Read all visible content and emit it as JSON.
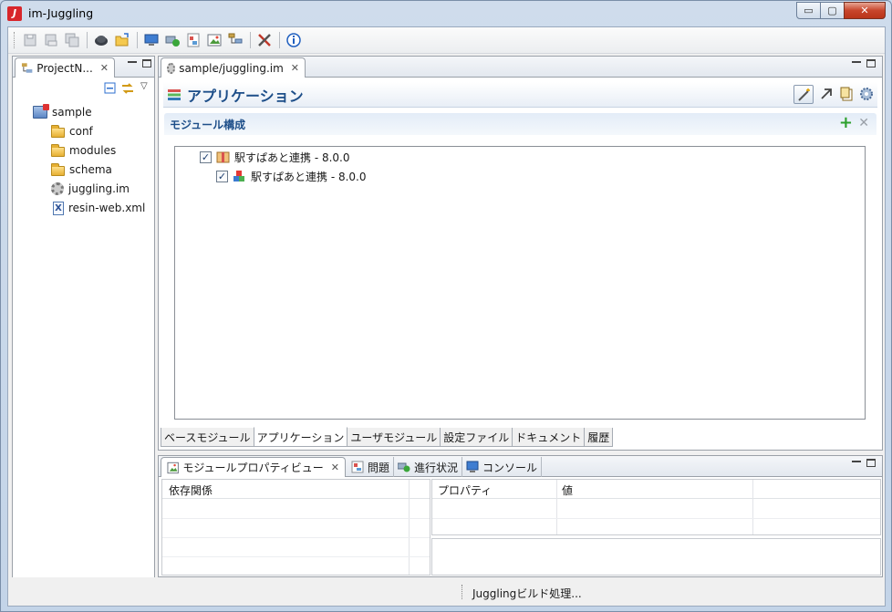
{
  "window": {
    "title": "im-Juggling",
    "controls": {
      "minimize": "▭",
      "maximize": "▢",
      "close": "✕"
    }
  },
  "toolbar": {
    "groups": [
      [
        "save-icon",
        "save-as-icon",
        "save-all-icon"
      ],
      [
        "hat-icon",
        "open-folder-icon"
      ],
      [
        "monitor-icon",
        "deploy-icon",
        "report-icon",
        "image-icon",
        "tree-icon"
      ],
      [
        "tools-icon"
      ],
      [
        "info-icon"
      ]
    ]
  },
  "project_explorer": {
    "tab_label": "ProjectN...",
    "tree": {
      "root": "sample",
      "children": [
        "conf",
        "modules",
        "schema",
        "juggling.im",
        "resin-web.xml"
      ]
    }
  },
  "editor": {
    "tab_label": "sample/juggling.im",
    "title": "アプリケーション",
    "section_title": "モジュール構成",
    "modules": [
      {
        "label": "駅すぱあと連携 - 8.0.0",
        "checked": true,
        "level": 0
      },
      {
        "label": "駅すぱあと連携 - 8.0.0",
        "checked": true,
        "level": 1
      }
    ],
    "bottom_tabs": [
      "ベースモジュール",
      "アプリケーション",
      "ユーザモジュール",
      "設定ファイル",
      "ドキュメント",
      "履歴"
    ],
    "active_bottom_tab": 1
  },
  "bottom_view": {
    "tabs": [
      "モジュールプロパティビュー",
      "問題",
      "進行状況",
      "コンソール"
    ],
    "dependency_header": "依存関係",
    "property_headers": [
      "プロパティ",
      "値"
    ]
  },
  "status": {
    "text": "Jugglingビルド処理..."
  },
  "colors": {
    "title_blue": "#1d4e89",
    "add_green": "#2ca02c",
    "close_red": "#c8452b"
  }
}
